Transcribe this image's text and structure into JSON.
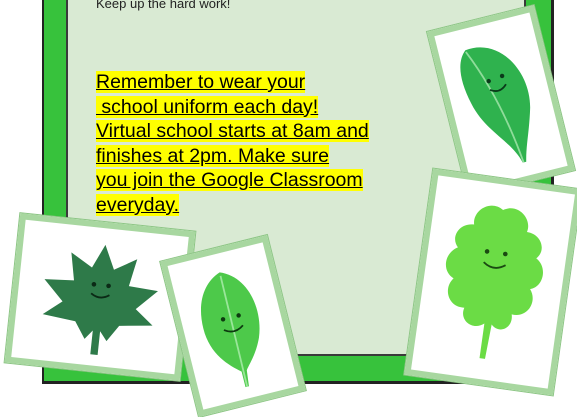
{
  "top_text": "Keep up the hard work!",
  "reminder_lines": [
    "Remember to wear your",
    " school uniform each day!",
    "Virtual school starts at 8am and",
    "finishes at 2pm. Make sure",
    "you join the Google Classroom",
    "everyday."
  ],
  "colors": {
    "frame": "#37c23c",
    "panel": "#d9ead3",
    "highlight": "#ffff00",
    "card_border": "#a8d7a0"
  },
  "stickers": [
    "maple-leaf-icon",
    "oval-leaf-icon",
    "long-leaf-icon",
    "oak-leaf-icon"
  ]
}
